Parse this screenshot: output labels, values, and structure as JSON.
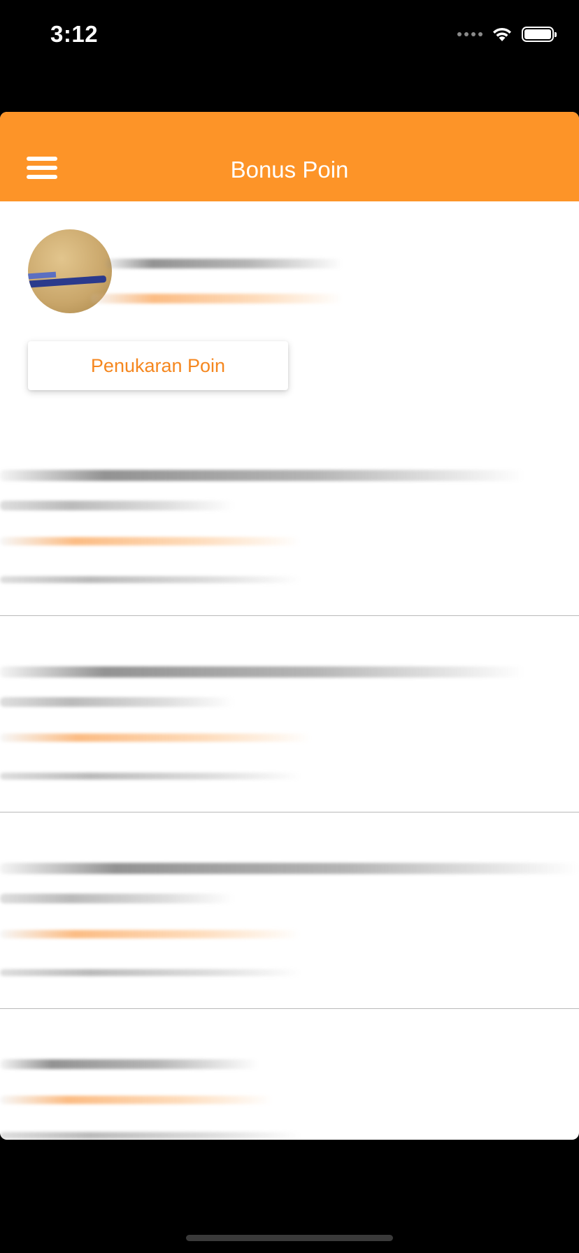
{
  "status_bar": {
    "time": "3:12"
  },
  "header": {
    "title": "Bonus Poin",
    "menu_icon": "hamburger-menu-icon"
  },
  "profile": {
    "avatar": "profile-photo"
  },
  "actions": {
    "exchange_label": "Penukaran Poin"
  },
  "colors": {
    "accent": "#fd9428",
    "accent_text": "#f5871f",
    "background": "#ffffff"
  }
}
